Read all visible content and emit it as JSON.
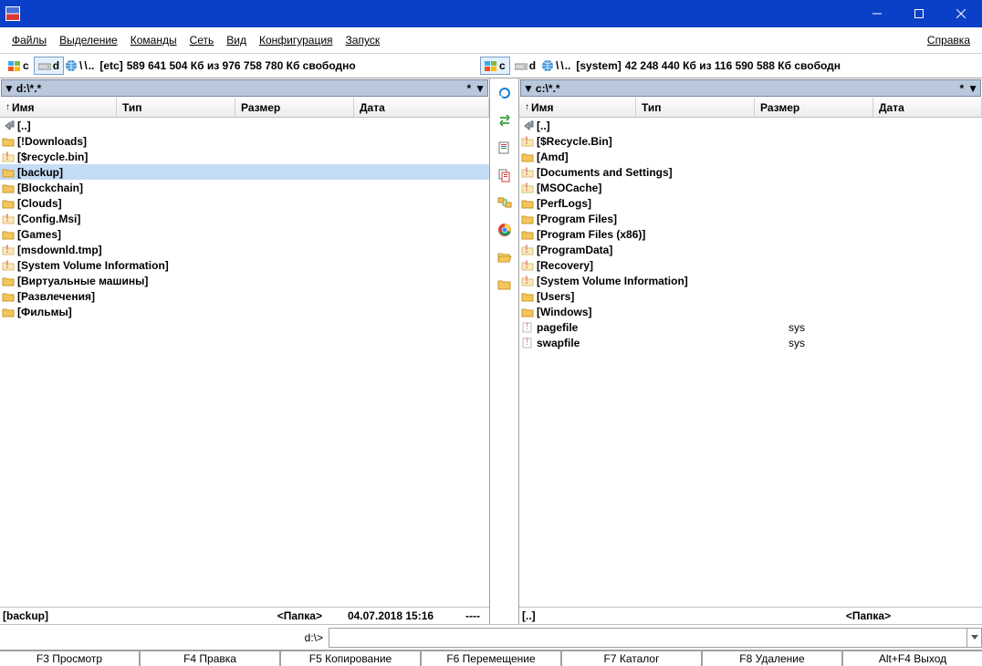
{
  "menu": {
    "files": "Файлы",
    "select": "Выделение",
    "commands": "Команды",
    "net": "Сеть",
    "view": "Вид",
    "config": "Конфигурация",
    "start": "Запуск",
    "help": "Справка"
  },
  "drives": {
    "left": {
      "c": "c",
      "d": "d",
      "etc": "[etc]",
      "free": "589 641 504 Кб из 976 758 780 Кб свободно"
    },
    "right": {
      "c": "c",
      "d": "d",
      "etc": "[system]",
      "free": "42 248 440 Кб из 116 590 588 Кб свободн"
    }
  },
  "pathLeft": "d:\\*.*",
  "pathRight": "c:\\*.*",
  "cols": {
    "name": "Имя",
    "type": "Тип",
    "size": "Размер",
    "date": "Дата"
  },
  "left": {
    "items": [
      {
        "t": "up",
        "name": "[..]"
      },
      {
        "t": "fld",
        "name": "[!Downloads]"
      },
      {
        "t": "hid",
        "name": "[$recycle.bin]"
      },
      {
        "t": "fld",
        "name": "[backup]",
        "sel": true
      },
      {
        "t": "fld",
        "name": "[Blockchain]"
      },
      {
        "t": "fld",
        "name": "[Clouds]"
      },
      {
        "t": "hid",
        "name": "[Config.Msi]"
      },
      {
        "t": "fld",
        "name": "[Games]"
      },
      {
        "t": "hid",
        "name": "[msdownld.tmp]"
      },
      {
        "t": "hid",
        "name": "[System Volume Information]"
      },
      {
        "t": "fld",
        "name": "[Виртуальные машины]"
      },
      {
        "t": "fld",
        "name": "[Развлечения]"
      },
      {
        "t": "fld",
        "name": "[Фильмы]"
      }
    ],
    "status": {
      "name": "[backup]",
      "folder": "<Папка>",
      "date": "04.07.2018 15:16",
      "attr": "----"
    }
  },
  "right": {
    "items": [
      {
        "t": "up",
        "name": "[..]"
      },
      {
        "t": "hid",
        "name": "[$Recycle.Bin]"
      },
      {
        "t": "fld",
        "name": "[Amd]"
      },
      {
        "t": "hid",
        "name": "[Documents and Settings]"
      },
      {
        "t": "hid",
        "name": "[MSOCache]"
      },
      {
        "t": "fld",
        "name": "[PerfLogs]"
      },
      {
        "t": "fld",
        "name": "[Program Files]"
      },
      {
        "t": "fld",
        "name": "[Program Files (x86)]"
      },
      {
        "t": "hid",
        "name": "[ProgramData]"
      },
      {
        "t": "hid",
        "name": "[Recovery]"
      },
      {
        "t": "hid",
        "name": "[System Volume Information]"
      },
      {
        "t": "fld",
        "name": "[Users]"
      },
      {
        "t": "fld",
        "name": "[Windows]"
      },
      {
        "t": "file",
        "name": "pagefile",
        "ext": "sys"
      },
      {
        "t": "file",
        "name": "swapfile",
        "ext": "sys"
      }
    ],
    "status": {
      "name": "[..]",
      "folder": "<Папка>"
    }
  },
  "cmdprompt": "d:\\>",
  "fn": {
    "f3": "F3 Просмотр",
    "f4": "F4 Правка",
    "f5": "F5 Копирование",
    "f6": "F6 Перемещение",
    "f7": "F7 Каталог",
    "f8": "F8 Удаление",
    "altf4": "Alt+F4 Выход"
  },
  "slash": "\\",
  "dots": ".."
}
